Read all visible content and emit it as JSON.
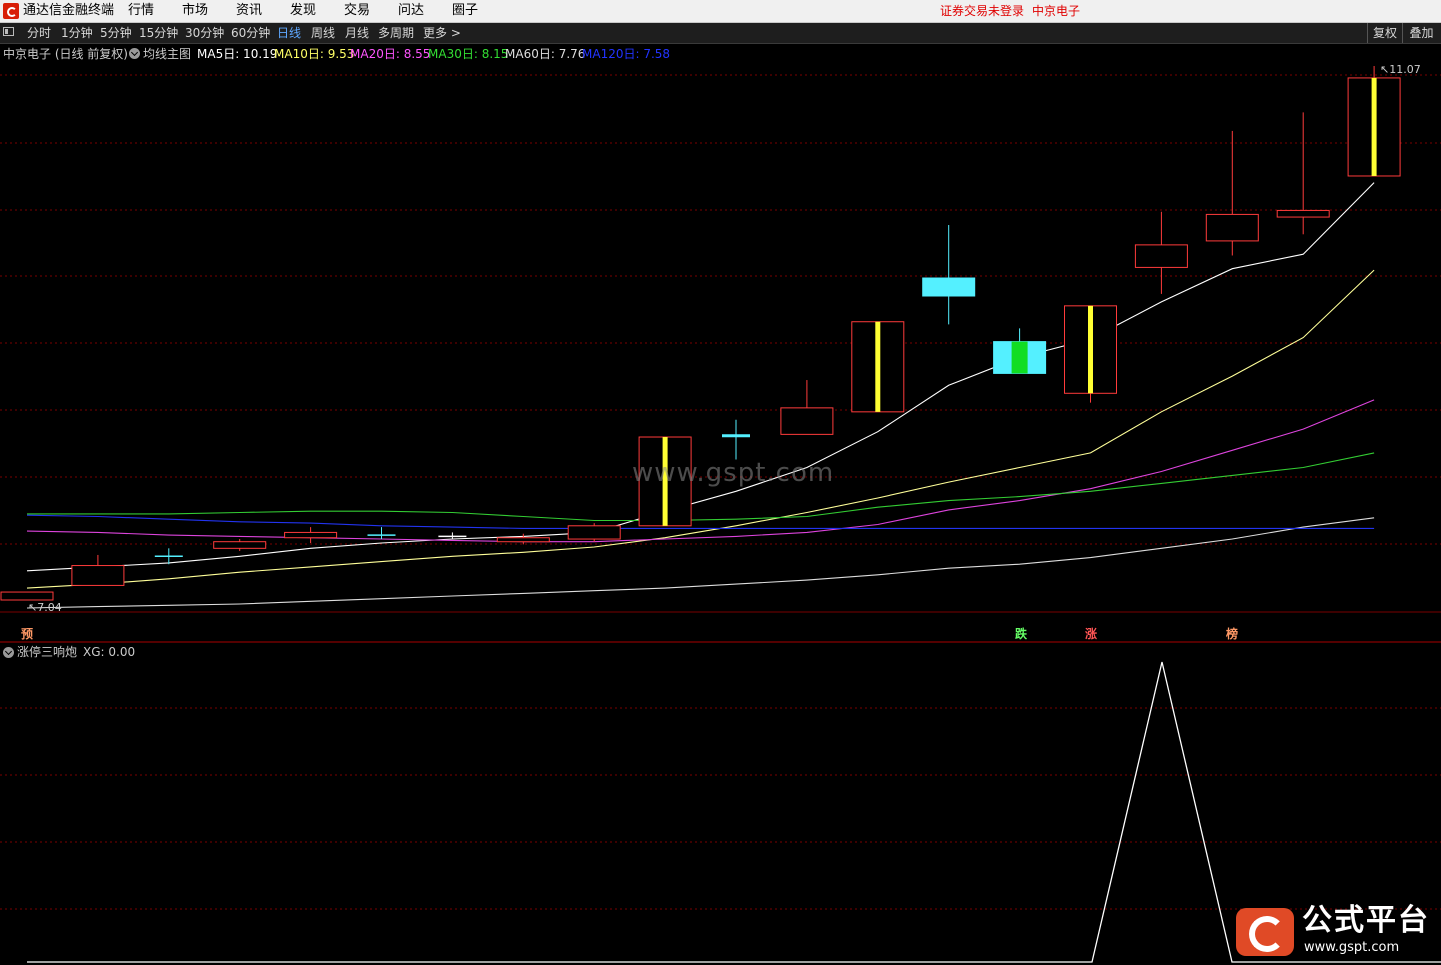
{
  "app": {
    "title": "通达信金融终端",
    "menu": [
      "行情",
      "市场",
      "资讯",
      "发现",
      "交易",
      "问达",
      "圈子"
    ],
    "status_login": "证券交易未登录",
    "stock_name": "中京电子"
  },
  "toolbar": {
    "periods": [
      "分时",
      "1分钟",
      "5分钟",
      "15分钟",
      "30分钟",
      "60分钟",
      "日线",
      "周线",
      "月线",
      "多周期",
      "更多 >"
    ],
    "active_period": "日线",
    "right_buttons": [
      "复权",
      "叠加"
    ]
  },
  "main_chart": {
    "title": "中京电子 (日线 前复权)",
    "indicator_name": "均线主图",
    "ma": [
      {
        "label": "MA5日: 10.19",
        "color": "#ffffff"
      },
      {
        "label": "MA10日: 9.53",
        "color": "#ffff66"
      },
      {
        "label": "MA20日: 8.55",
        "color": "#ff55ff"
      },
      {
        "label": "MA30日: 8.15",
        "color": "#33dd33"
      },
      {
        "label": "MA60日: 7.76",
        "color": "#dddddd"
      },
      {
        "label": "MA120日: 7.58",
        "color": "#2233ff"
      }
    ],
    "high_label": "11.07",
    "low_label": "7.04",
    "signals": [
      {
        "text": "预",
        "color": "#ff9966"
      },
      {
        "text": "跌",
        "color": "#66ff66"
      },
      {
        "text": "涨",
        "color": "#ff5555"
      },
      {
        "text": "榜",
        "color": "#ff9966"
      }
    ]
  },
  "sub_chart": {
    "name": "涨停三响炮",
    "value_label": "XG: 0.00"
  },
  "watermark": {
    "center": "www.gspt.com",
    "brand": "公式平台",
    "url": "www.gspt.com"
  },
  "chart_data": {
    "type": "candlestick",
    "y_range": [
      7.04,
      11.07
    ],
    "candles": [
      {
        "o": 7.1,
        "c": 7.04,
        "h": 7.1,
        "l": 7.04,
        "dir": "down-red"
      },
      {
        "o": 7.15,
        "c": 7.3,
        "h": 7.38,
        "l": 7.15,
        "dir": "up"
      },
      {
        "o": 7.37,
        "c": 7.37,
        "h": 7.43,
        "l": 7.31,
        "dir": "doji-cyan"
      },
      {
        "o": 7.43,
        "c": 7.48,
        "h": 7.5,
        "l": 7.41,
        "dir": "up"
      },
      {
        "o": 7.51,
        "c": 7.55,
        "h": 7.59,
        "l": 7.47,
        "dir": "up"
      },
      {
        "o": 7.53,
        "c": 7.53,
        "h": 7.59,
        "l": 7.5,
        "dir": "doji-cyan"
      },
      {
        "o": 7.52,
        "c": 7.52,
        "h": 7.55,
        "l": 7.5,
        "dir": "doji-white"
      },
      {
        "o": 7.49,
        "c": 7.51,
        "h": 7.54,
        "l": 7.46,
        "dir": "up"
      },
      {
        "o": 7.5,
        "c": 7.6,
        "h": 7.62,
        "l": 7.48,
        "dir": "up"
      },
      {
        "o": 7.6,
        "c": 8.27,
        "h": 8.27,
        "l": 7.6,
        "dir": "limit-up"
      },
      {
        "o": 8.28,
        "c": 8.28,
        "h": 8.4,
        "l": 8.1,
        "dir": "doji-cyan"
      },
      {
        "o": 8.29,
        "c": 8.49,
        "h": 8.7,
        "l": 8.29,
        "dir": "up"
      },
      {
        "o": 8.46,
        "c": 9.14,
        "h": 9.14,
        "l": 8.46,
        "dir": "limit-up"
      },
      {
        "o": 9.47,
        "c": 9.38,
        "h": 9.87,
        "l": 9.12,
        "dir": "down-cyan"
      },
      {
        "o": 8.75,
        "c": 8.99,
        "h": 9.09,
        "l": 8.77,
        "dir": "down-cyan"
      },
      {
        "o": 8.6,
        "c": 9.26,
        "h": 9.26,
        "l": 8.53,
        "dir": "limit-up"
      },
      {
        "o": 9.72,
        "c": 9.55,
        "h": 9.97,
        "l": 9.35,
        "dir": "up"
      },
      {
        "o": 9.95,
        "c": 9.75,
        "h": 10.58,
        "l": 9.64,
        "dir": "up"
      },
      {
        "o": 9.93,
        "c": 9.98,
        "h": 10.72,
        "l": 9.8,
        "dir": "up"
      },
      {
        "o": 10.24,
        "c": 10.98,
        "h": 11.07,
        "l": 10.24,
        "dir": "limit-up"
      }
    ],
    "ma_lines": {
      "MA5": [
        7.26,
        7.29,
        7.32,
        7.37,
        7.43,
        7.47,
        7.5,
        7.52,
        7.55,
        7.71,
        7.86,
        8.04,
        8.31,
        8.66,
        8.87,
        9.01,
        9.29,
        9.54,
        9.65,
        10.19
      ],
      "MA10": [
        7.13,
        7.16,
        7.2,
        7.25,
        7.29,
        7.33,
        7.37,
        7.4,
        7.44,
        7.51,
        7.6,
        7.7,
        7.81,
        7.93,
        8.04,
        8.15,
        8.46,
        8.73,
        9.02,
        9.53
      ],
      "MA20": [
        7.56,
        7.55,
        7.53,
        7.52,
        7.51,
        7.5,
        7.49,
        7.48,
        7.48,
        7.5,
        7.52,
        7.55,
        7.61,
        7.72,
        7.79,
        7.88,
        8.01,
        8.17,
        8.33,
        8.55
      ],
      "MA30": [
        7.69,
        7.69,
        7.69,
        7.7,
        7.71,
        7.71,
        7.7,
        7.67,
        7.64,
        7.64,
        7.65,
        7.67,
        7.74,
        7.79,
        7.82,
        7.86,
        7.92,
        7.98,
        8.04,
        8.15
      ],
      "MA60": [
        6.98,
        6.99,
        7.0,
        7.01,
        7.03,
        7.05,
        7.07,
        7.09,
        7.11,
        7.13,
        7.16,
        7.19,
        7.23,
        7.28,
        7.31,
        7.36,
        7.43,
        7.5,
        7.59,
        7.66
      ],
      "MA120": [
        7.68,
        7.67,
        7.65,
        7.63,
        7.62,
        7.6,
        7.59,
        7.58,
        7.58,
        7.58,
        7.58,
        7.58,
        7.58,
        7.58,
        7.58,
        7.58,
        7.58,
        7.58,
        7.58,
        7.58
      ]
    },
    "xg": {
      "x_index": [
        15,
        16,
        17
      ],
      "values": [
        0,
        1,
        0
      ]
    }
  }
}
